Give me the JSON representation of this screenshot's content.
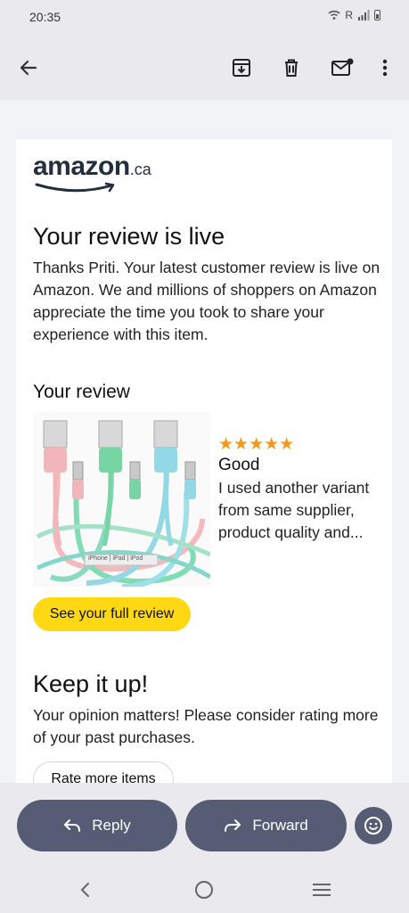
{
  "status": {
    "time": "20:35",
    "carrier": "R"
  },
  "email": {
    "logo": {
      "brand": "amazon",
      "tld": ".ca"
    },
    "title": "Your review is live",
    "intro": "Thanks Priti. Your latest customer review is live on Amazon. We and millions of shoppers on Amazon appreciate the time you took to share your experience with this item.",
    "review_heading": "Your review",
    "review": {
      "rating": 5,
      "stars": "★★★★★",
      "title": "Good",
      "body": "I used another variant from same supplier, product quality and..."
    },
    "product_image_label": "iPhone | iPad | iPod",
    "see_review_button": "See your full review",
    "keep_heading": "Keep it up!",
    "keep_body": "Your opinion matters! Please consider rating more of your past purchases.",
    "rate_button": "Rate more items"
  },
  "actions": {
    "reply": "Reply",
    "forward": "Forward"
  },
  "colors": {
    "accent_yellow": "#ffd814",
    "star": "#f6961c",
    "pill": "#555c74"
  }
}
